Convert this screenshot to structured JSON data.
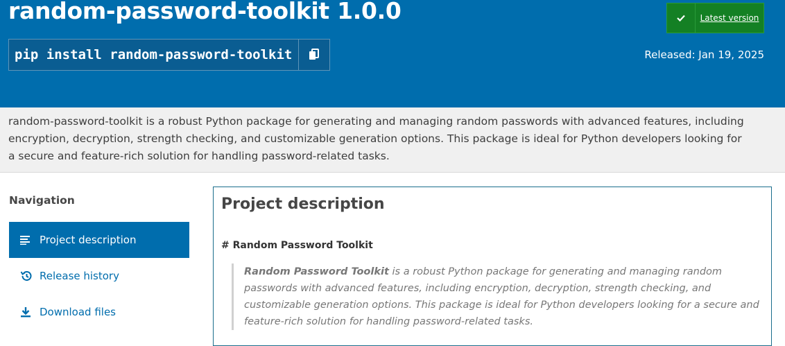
{
  "header": {
    "title": "random-password-toolkit 1.0.0",
    "pip_command": "pip install random-password-toolkit",
    "latest_version_label": "Latest version",
    "released": "Released: Jan 19, 2025",
    "colors": {
      "header_bg": "#006dad",
      "latest_bg": "#148024"
    }
  },
  "summary": "random-password-toolkit is a robust Python package for generating and managing random passwords with advanced features, including encryption, decryption, strength checking, and customizable generation options. This package is ideal for Python developers looking for a secure and feature-rich solution for handling password-related tasks.",
  "sidebar": {
    "heading": "Navigation",
    "items": [
      {
        "label": "Project description",
        "icon": "list-lines-icon",
        "active": true
      },
      {
        "label": "Release history",
        "icon": "history-icon",
        "active": false
      },
      {
        "label": "Download files",
        "icon": "download-icon",
        "active": false
      }
    ]
  },
  "main": {
    "title": "Project description",
    "markdown_heading": "# Random Password Toolkit",
    "quote_bold": "Random Password Toolkit",
    "quote_rest": " is a robust Python package for generating and managing random passwords with advanced features, including encryption, decryption, strength checking, and customizable generation options. This package is ideal for Python developers looking for a secure and feature-rich solution for handling password-related tasks."
  }
}
